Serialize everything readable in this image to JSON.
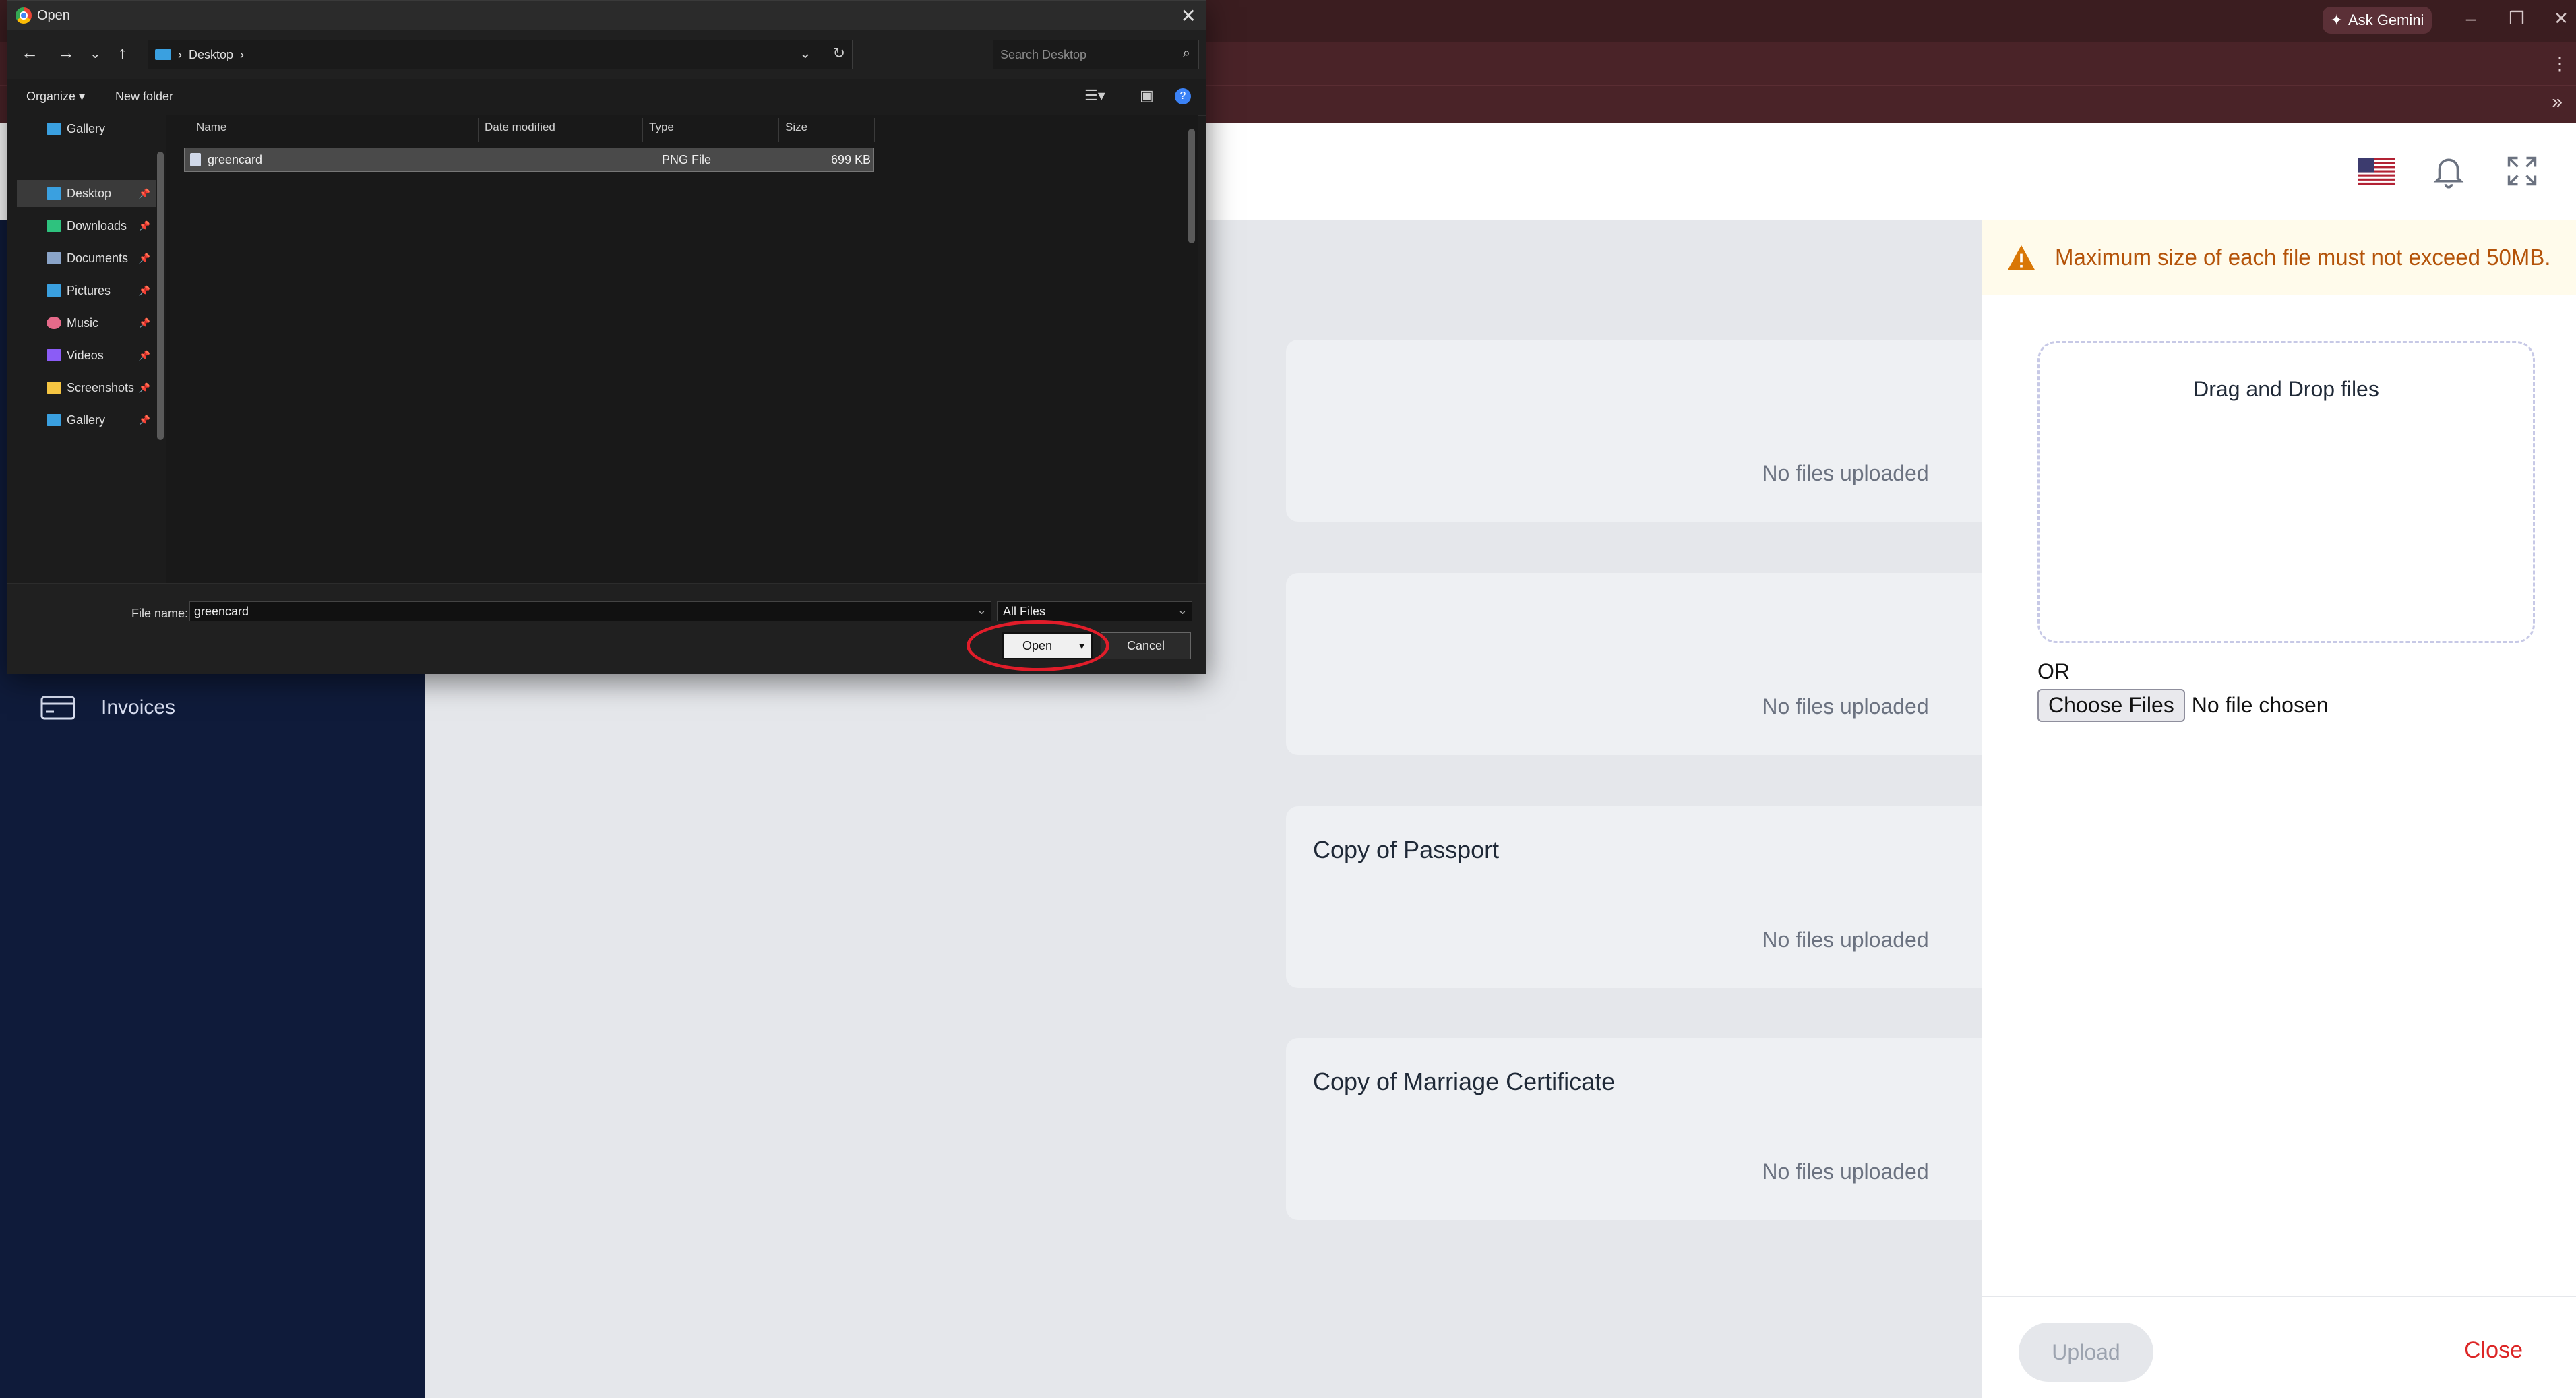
{
  "browser": {
    "gemini_label": "Ask Gemini",
    "bookmarks_overflow": "»"
  },
  "sidebar": {
    "items": [
      {
        "label": "Invoices",
        "icon": "credit-card-icon"
      }
    ]
  },
  "main": {
    "cards": [
      {
        "title": "",
        "empty": "No files uploaded"
      },
      {
        "title": "",
        "empty": "No files uploaded"
      },
      {
        "title": "Copy of Passport",
        "empty": "No files uploaded"
      },
      {
        "title": "Copy of Marriage Certificate",
        "empty": "No files uploaded"
      }
    ]
  },
  "panel": {
    "warning": "Maximum size of each file must not exceed 50MB.",
    "dropzone_label": "Drag and Drop files",
    "or_label": "OR",
    "choose_label": "Choose Files",
    "no_file_label": "No file chosen",
    "upload_label": "Upload",
    "close_label": "Close"
  },
  "dialog": {
    "title": "Open",
    "path": "Desktop",
    "search_placeholder": "Search Desktop",
    "organize_label": "Organize ▾",
    "new_folder_label": "New folder",
    "nav_items": [
      {
        "label": "Gallery",
        "color": "#3aa0e0",
        "pinned": false
      },
      {
        "label": "Desktop",
        "color": "#3aa0e0",
        "pinned": true
      },
      {
        "label": "Downloads",
        "color": "#2ec27e",
        "pinned": true
      },
      {
        "label": "Documents",
        "color": "#8aa4c8",
        "pinned": true
      },
      {
        "label": "Pictures",
        "color": "#3aa0e0",
        "pinned": true
      },
      {
        "label": "Music",
        "color": "#e66a8a",
        "pinned": true
      },
      {
        "label": "Videos",
        "color": "#8b5cf6",
        "pinned": true
      },
      {
        "label": "Screenshots",
        "color": "#f5c542",
        "pinned": true
      },
      {
        "label": "Gallery",
        "color": "#3aa0e0",
        "pinned": true
      }
    ],
    "columns": [
      "Name",
      "Date modified",
      "Type",
      "Size"
    ],
    "files": [
      {
        "name": "greencard",
        "modified": "",
        "type": "PNG File",
        "size": "699 KB"
      }
    ],
    "filename_label": "File name:",
    "filename_value": "greencard",
    "filetype_value": "All Files",
    "open_label": "Open",
    "cancel_label": "Cancel"
  },
  "colors": {
    "sidebar_bg": "#0f1b3a",
    "warning_text": "#b45309",
    "close_text": "#dc2626",
    "highlight": "#e11d2a"
  }
}
